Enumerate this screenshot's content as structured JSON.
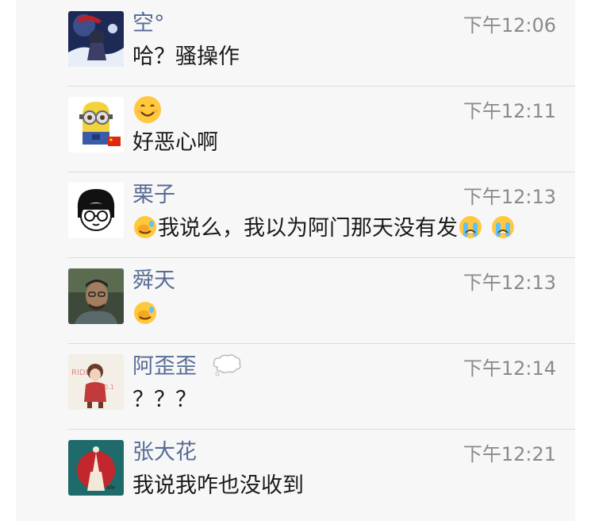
{
  "messages": [
    {
      "sender": "空°",
      "time": "下午12:06",
      "text": "哈？骚操作",
      "avatar": "anime-avatar"
    },
    {
      "sender": "",
      "time": "下午12:11",
      "text": "好恶心啊",
      "avatar": "minion-avatar",
      "sender_emoji": "smile-emoji"
    },
    {
      "sender": "栗子",
      "time": "下午12:13",
      "text": "我说么，我以为阿门那天没有发",
      "avatar": "cartoon-girl-avatar",
      "prefix_emoji": "facepalm-emoji",
      "suffix_emoji": "crying-emoji"
    },
    {
      "sender": "舜天",
      "time": "下午12:13",
      "text": "",
      "avatar": "man-photo-avatar",
      "only_emoji": "facepalm-emoji"
    },
    {
      "sender": "阿歪歪",
      "time": "下午12:14",
      "text": "？？？",
      "avatar": "doodle-girl-avatar",
      "name_icon": "thought-bubble-icon"
    },
    {
      "sender": "张大花",
      "time": "下午12:21",
      "text": "我说我咋也没收到",
      "avatar": "red-circle-woman-avatar"
    }
  ],
  "colors": {
    "name": "#576b95",
    "time": "#8a8a8a",
    "text": "#1a1a1a",
    "background": "#f7f7f7"
  }
}
